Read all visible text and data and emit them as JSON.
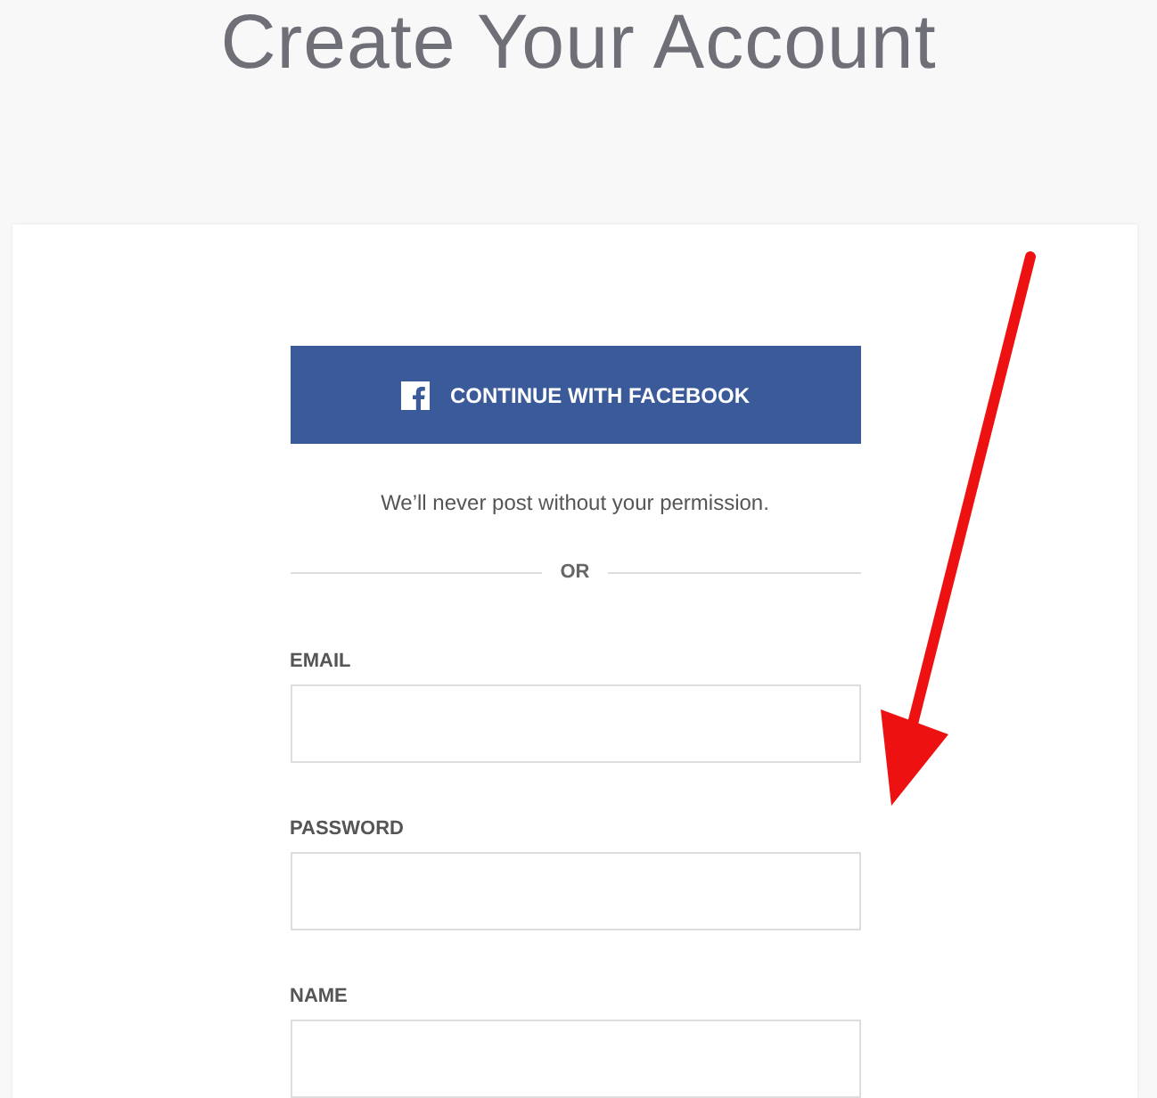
{
  "title": "Create Your Account",
  "facebook_button": {
    "label": "CONTINUE WITH FACEBOOK"
  },
  "note": "We’ll never post without your permission.",
  "divider": {
    "label": "OR"
  },
  "fields": [
    {
      "label": "EMAIL"
    },
    {
      "label": "PASSWORD"
    },
    {
      "label": "NAME"
    }
  ]
}
